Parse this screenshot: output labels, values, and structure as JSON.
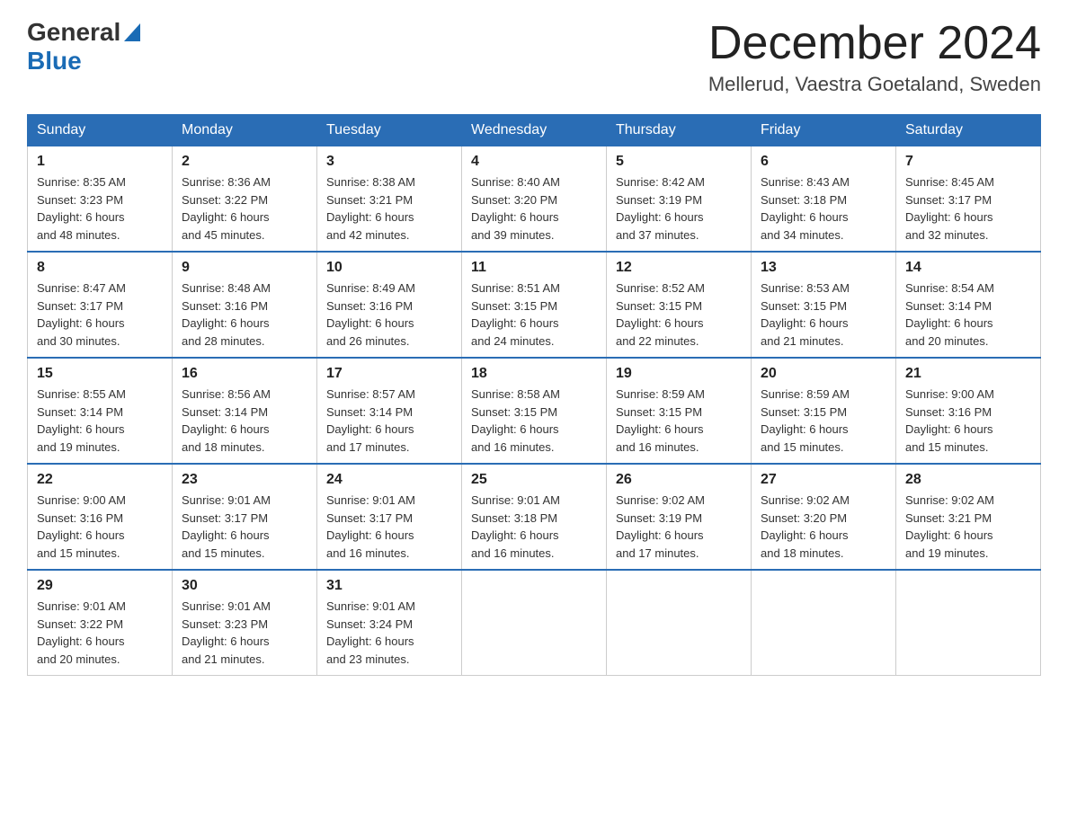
{
  "header": {
    "logo_general": "General",
    "logo_blue": "Blue",
    "month_year": "December 2024",
    "location": "Mellerud, Vaestra Goetaland, Sweden"
  },
  "days_of_week": [
    "Sunday",
    "Monday",
    "Tuesday",
    "Wednesday",
    "Thursday",
    "Friday",
    "Saturday"
  ],
  "weeks": [
    [
      {
        "day": "1",
        "sunrise": "8:35 AM",
        "sunset": "3:23 PM",
        "daylight": "6 hours and 48 minutes."
      },
      {
        "day": "2",
        "sunrise": "8:36 AM",
        "sunset": "3:22 PM",
        "daylight": "6 hours and 45 minutes."
      },
      {
        "day": "3",
        "sunrise": "8:38 AM",
        "sunset": "3:21 PM",
        "daylight": "6 hours and 42 minutes."
      },
      {
        "day": "4",
        "sunrise": "8:40 AM",
        "sunset": "3:20 PM",
        "daylight": "6 hours and 39 minutes."
      },
      {
        "day": "5",
        "sunrise": "8:42 AM",
        "sunset": "3:19 PM",
        "daylight": "6 hours and 37 minutes."
      },
      {
        "day": "6",
        "sunrise": "8:43 AM",
        "sunset": "3:18 PM",
        "daylight": "6 hours and 34 minutes."
      },
      {
        "day": "7",
        "sunrise": "8:45 AM",
        "sunset": "3:17 PM",
        "daylight": "6 hours and 32 minutes."
      }
    ],
    [
      {
        "day": "8",
        "sunrise": "8:47 AM",
        "sunset": "3:17 PM",
        "daylight": "6 hours and 30 minutes."
      },
      {
        "day": "9",
        "sunrise": "8:48 AM",
        "sunset": "3:16 PM",
        "daylight": "6 hours and 28 minutes."
      },
      {
        "day": "10",
        "sunrise": "8:49 AM",
        "sunset": "3:16 PM",
        "daylight": "6 hours and 26 minutes."
      },
      {
        "day": "11",
        "sunrise": "8:51 AM",
        "sunset": "3:15 PM",
        "daylight": "6 hours and 24 minutes."
      },
      {
        "day": "12",
        "sunrise": "8:52 AM",
        "sunset": "3:15 PM",
        "daylight": "6 hours and 22 minutes."
      },
      {
        "day": "13",
        "sunrise": "8:53 AM",
        "sunset": "3:15 PM",
        "daylight": "6 hours and 21 minutes."
      },
      {
        "day": "14",
        "sunrise": "8:54 AM",
        "sunset": "3:14 PM",
        "daylight": "6 hours and 20 minutes."
      }
    ],
    [
      {
        "day": "15",
        "sunrise": "8:55 AM",
        "sunset": "3:14 PM",
        "daylight": "6 hours and 19 minutes."
      },
      {
        "day": "16",
        "sunrise": "8:56 AM",
        "sunset": "3:14 PM",
        "daylight": "6 hours and 18 minutes."
      },
      {
        "day": "17",
        "sunrise": "8:57 AM",
        "sunset": "3:14 PM",
        "daylight": "6 hours and 17 minutes."
      },
      {
        "day": "18",
        "sunrise": "8:58 AM",
        "sunset": "3:15 PM",
        "daylight": "6 hours and 16 minutes."
      },
      {
        "day": "19",
        "sunrise": "8:59 AM",
        "sunset": "3:15 PM",
        "daylight": "6 hours and 16 minutes."
      },
      {
        "day": "20",
        "sunrise": "8:59 AM",
        "sunset": "3:15 PM",
        "daylight": "6 hours and 15 minutes."
      },
      {
        "day": "21",
        "sunrise": "9:00 AM",
        "sunset": "3:16 PM",
        "daylight": "6 hours and 15 minutes."
      }
    ],
    [
      {
        "day": "22",
        "sunrise": "9:00 AM",
        "sunset": "3:16 PM",
        "daylight": "6 hours and 15 minutes."
      },
      {
        "day": "23",
        "sunrise": "9:01 AM",
        "sunset": "3:17 PM",
        "daylight": "6 hours and 15 minutes."
      },
      {
        "day": "24",
        "sunrise": "9:01 AM",
        "sunset": "3:17 PM",
        "daylight": "6 hours and 16 minutes."
      },
      {
        "day": "25",
        "sunrise": "9:01 AM",
        "sunset": "3:18 PM",
        "daylight": "6 hours and 16 minutes."
      },
      {
        "day": "26",
        "sunrise": "9:02 AM",
        "sunset": "3:19 PM",
        "daylight": "6 hours and 17 minutes."
      },
      {
        "day": "27",
        "sunrise": "9:02 AM",
        "sunset": "3:20 PM",
        "daylight": "6 hours and 18 minutes."
      },
      {
        "day": "28",
        "sunrise": "9:02 AM",
        "sunset": "3:21 PM",
        "daylight": "6 hours and 19 minutes."
      }
    ],
    [
      {
        "day": "29",
        "sunrise": "9:01 AM",
        "sunset": "3:22 PM",
        "daylight": "6 hours and 20 minutes."
      },
      {
        "day": "30",
        "sunrise": "9:01 AM",
        "sunset": "3:23 PM",
        "daylight": "6 hours and 21 minutes."
      },
      {
        "day": "31",
        "sunrise": "9:01 AM",
        "sunset": "3:24 PM",
        "daylight": "6 hours and 23 minutes."
      },
      null,
      null,
      null,
      null
    ]
  ],
  "labels": {
    "sunrise_prefix": "Sunrise:",
    "sunset_prefix": "Sunset:",
    "daylight_prefix": "Daylight:"
  }
}
